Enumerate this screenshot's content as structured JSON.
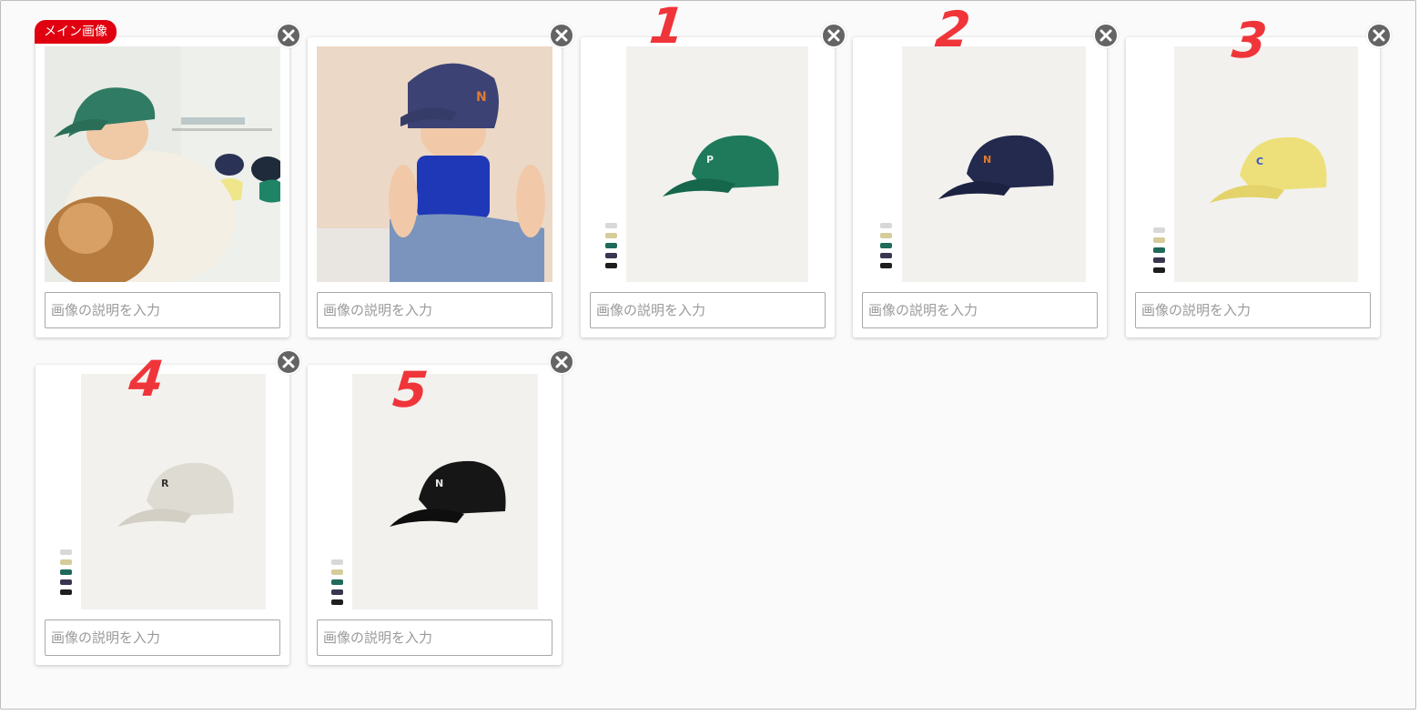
{
  "main_badge": "メイン画像",
  "description_placeholder": "画像の説明を入力",
  "annotations": [
    "1",
    "2",
    "3",
    "4",
    "5"
  ],
  "colors": {
    "badge": "#e0000f",
    "annotation": "#f0353a",
    "close_button": "#646464"
  },
  "cards": [
    {
      "subject": "child with green cap and dog",
      "cap_color": "#2f7b63"
    },
    {
      "subject": "child with navy cap",
      "cap_color": "#3c4374"
    },
    {
      "subject": "green cap",
      "cap_color": "#1f7a5c"
    },
    {
      "subject": "navy cap",
      "cap_color": "#232a4e"
    },
    {
      "subject": "yellow cap",
      "cap_color": "#ede07a"
    },
    {
      "subject": "beige cap",
      "cap_color": "#dedbd2"
    },
    {
      "subject": "black cap",
      "cap_color": "#161616"
    }
  ]
}
